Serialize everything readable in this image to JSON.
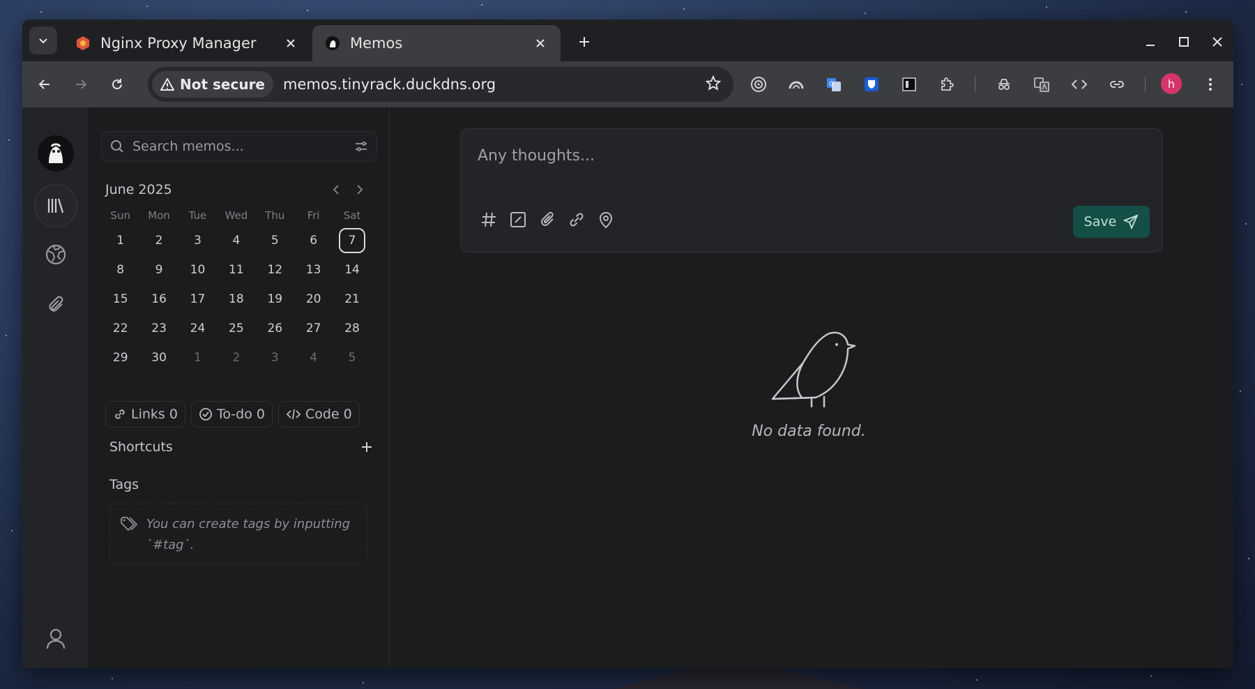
{
  "browser": {
    "tabs": [
      {
        "title": "Nginx Proxy Manager",
        "active": false
      },
      {
        "title": "Memos",
        "active": true
      }
    ],
    "security_label": "Not secure",
    "url": "memos.tinyrack.duckdns.org",
    "profile_initial": "h"
  },
  "sidebar": {
    "search_placeholder": "Search memos...",
    "calendar": {
      "month": "June 2025",
      "weekdays": [
        "Sun",
        "Mon",
        "Tue",
        "Wed",
        "Thu",
        "Fri",
        "Sat"
      ],
      "weeks": [
        [
          "1",
          "2",
          "3",
          "4",
          "5",
          "6",
          "7"
        ],
        [
          "8",
          "9",
          "10",
          "11",
          "12",
          "13",
          "14"
        ],
        [
          "15",
          "16",
          "17",
          "18",
          "19",
          "20",
          "21"
        ],
        [
          "22",
          "23",
          "24",
          "25",
          "26",
          "27",
          "28"
        ],
        [
          "29",
          "30",
          "1",
          "2",
          "3",
          "4",
          "5"
        ]
      ],
      "today": "7"
    },
    "stats": {
      "links": "Links 0",
      "todo": "To-do 0",
      "code": "Code 0"
    },
    "shortcuts_title": "Shortcuts",
    "tags_title": "Tags",
    "tags_empty": "You can create tags by inputting `#tag`."
  },
  "editor": {
    "placeholder": "Any thoughts...",
    "save_label": "Save"
  },
  "empty_state": {
    "message": "No data found."
  },
  "colors": {
    "accent": "#134f47",
    "profile": "#d8336b"
  }
}
